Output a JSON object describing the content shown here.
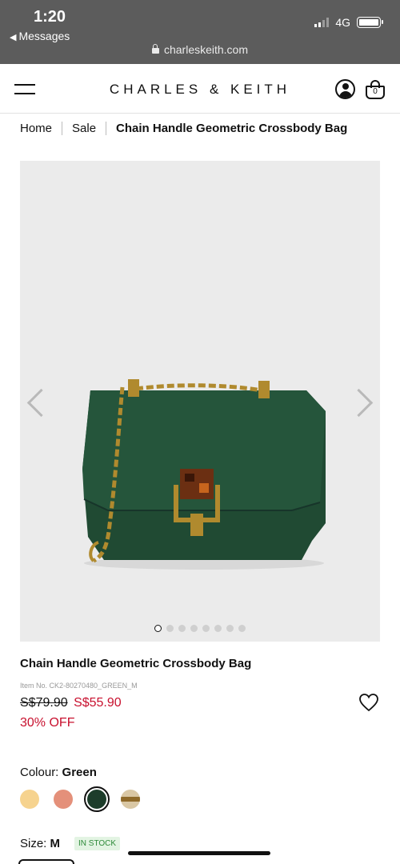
{
  "status_bar": {
    "time": "1:20",
    "back_label": "Messages",
    "network": "4G",
    "url": "charleskeith.com"
  },
  "header": {
    "logo": "CHARLES & KEITH",
    "cart_count": "0"
  },
  "breadcrumb": {
    "items": [
      "Home",
      "Sale"
    ],
    "current": "Chain Handle Geometric Crossbody Bag"
  },
  "gallery": {
    "image_count": 8,
    "active_index": 0
  },
  "product": {
    "name": "Chain Handle Geometric Crossbody Bag",
    "item_no": "Item No. CK2-80270480_GREEN_M",
    "old_price": "S$79.90",
    "new_price": "S$55.90",
    "discount": "30% OFF"
  },
  "colour": {
    "label": "Colour:",
    "selected": "Green",
    "swatches": [
      {
        "name": "yellow",
        "color": "#f6d38f"
      },
      {
        "name": "coral",
        "color": "#e4907a"
      },
      {
        "name": "green",
        "color": "#1d3d2b"
      },
      {
        "name": "gold",
        "color": "#d9c7a4"
      }
    ]
  },
  "size": {
    "label": "Size:",
    "selected": "M",
    "stock": "IN STOCK"
  },
  "colors": {
    "sale_red": "#c8102e",
    "bag_green": "#204a33",
    "hardware_gold": "#b08a2e"
  }
}
